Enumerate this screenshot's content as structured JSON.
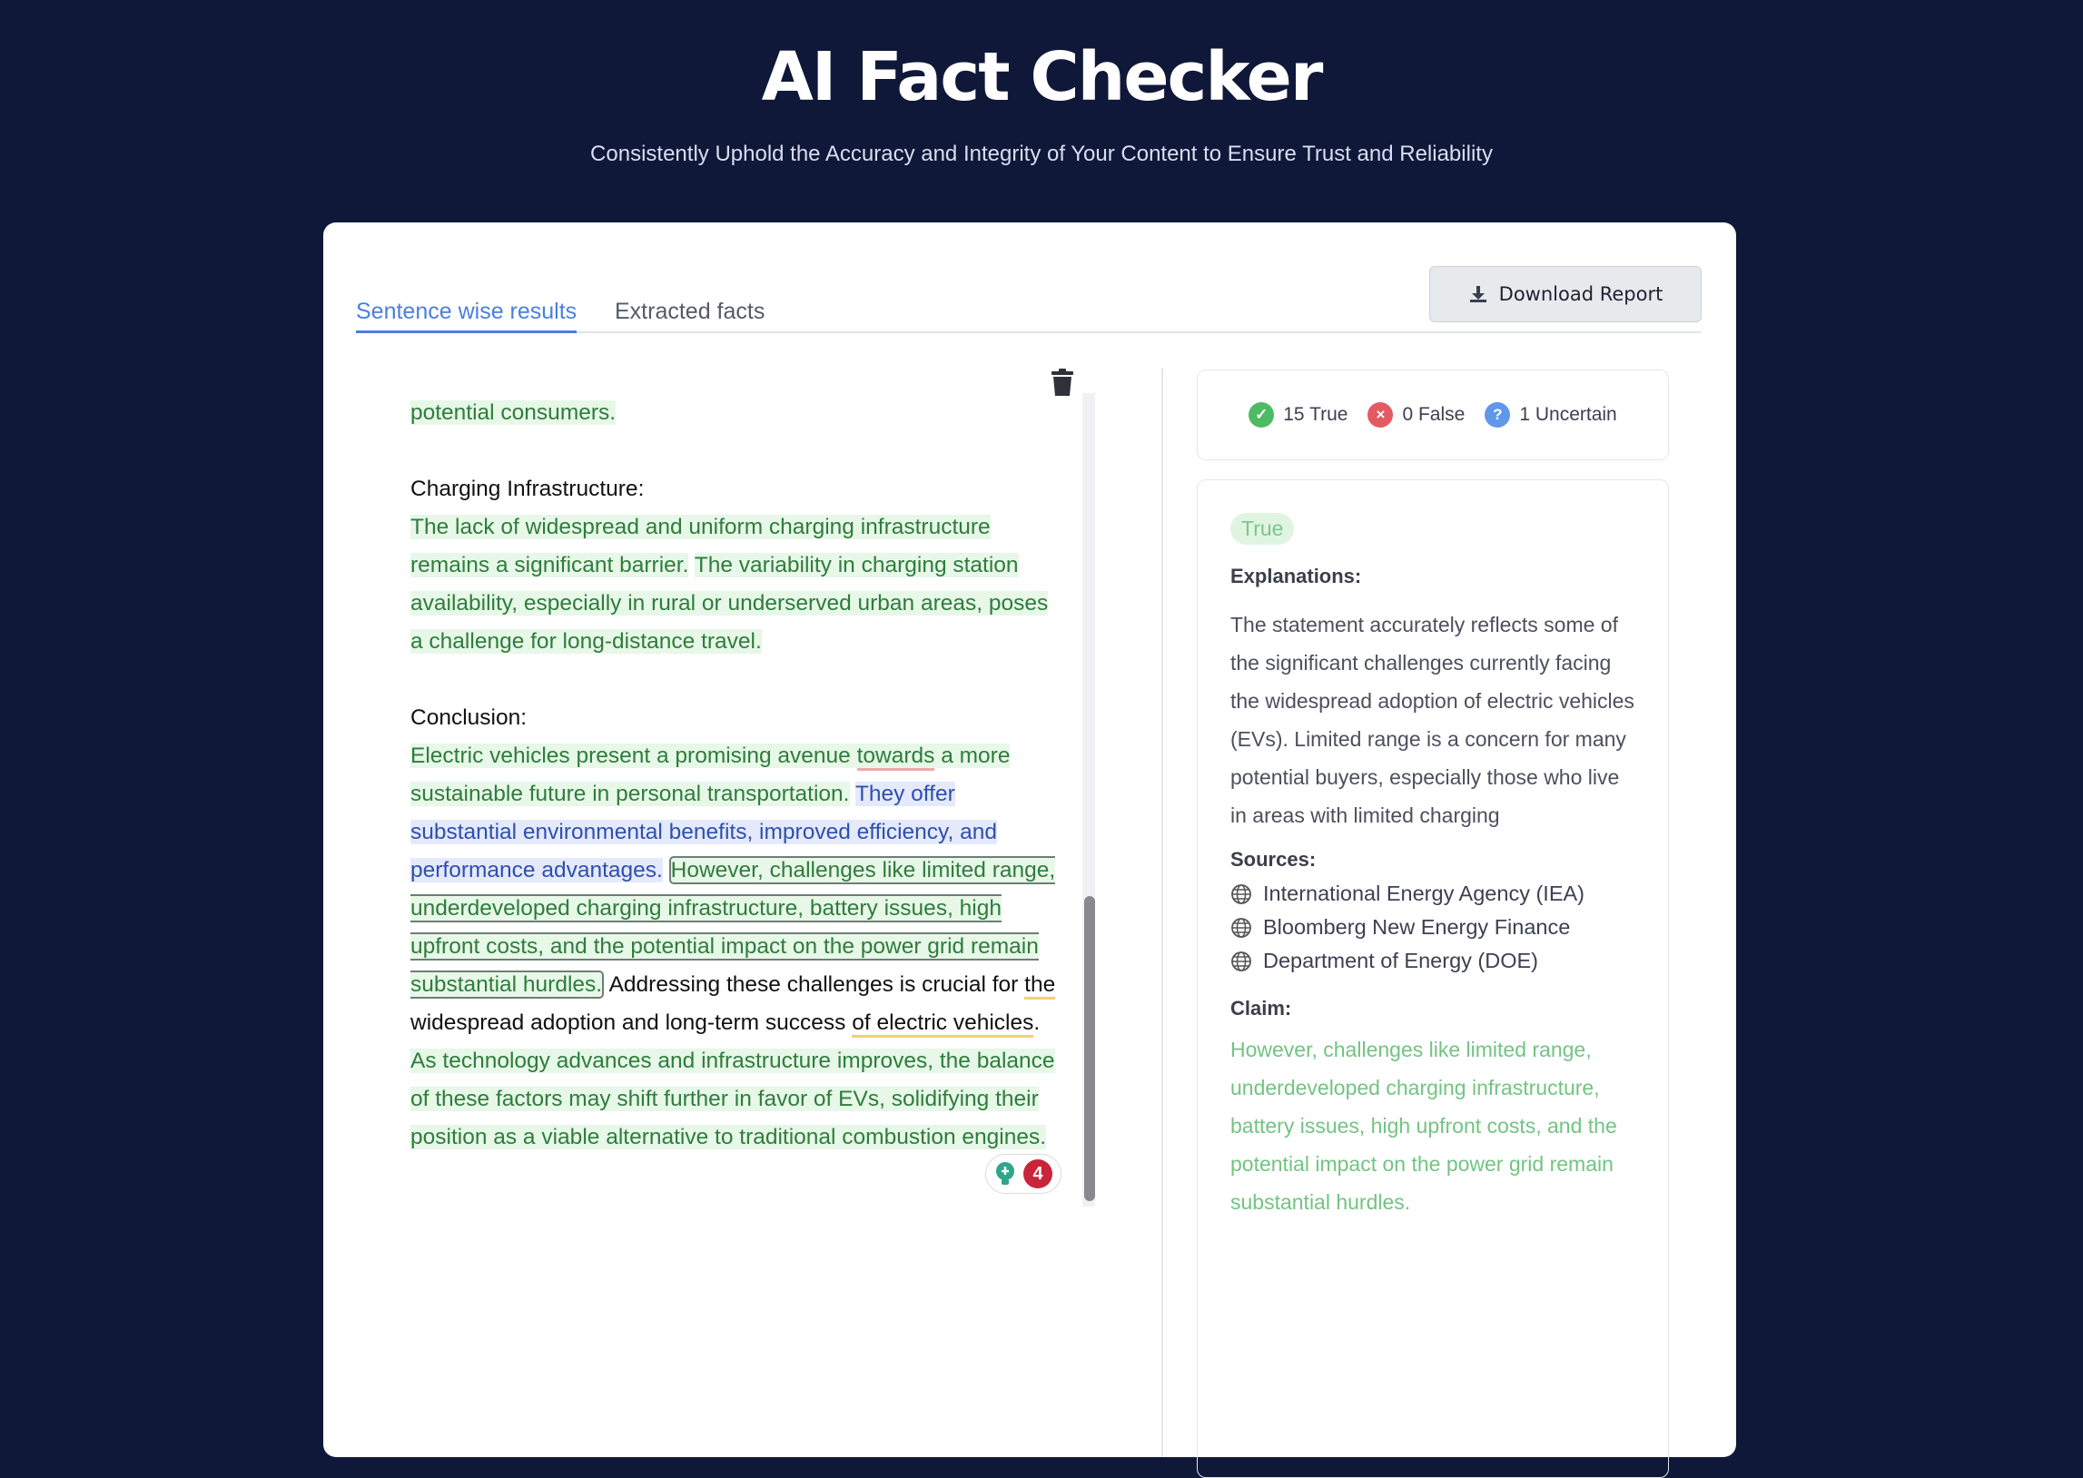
{
  "header": {
    "title": "AI Fact Checker",
    "subtitle": "Consistently Uphold the Accuracy and Integrity of Your Content to Ensure Trust and Reliability"
  },
  "tabs": [
    {
      "label": "Sentence wise results",
      "active": true
    },
    {
      "label": "Extracted facts",
      "active": false
    }
  ],
  "toolbar": {
    "download_label": "Download Report"
  },
  "editor": {
    "line_intro": "potential consumers.",
    "heading_charging": "Charging Infrastructure:",
    "charging_s1": "The lack of widespread and uniform charging infrastructure remains a significant barrier.",
    "charging_s2": "The variability in charging station availability, especially in rural or underserved urban areas, poses a challenge for long-distance travel.",
    "heading_conclusion": "Conclusion:",
    "c1_a": "Electric vehicles present a promising avenue ",
    "c1_b": "towards",
    "c1_c": " a more sustainable future in personal transportation.",
    "c2": "They offer substantial environmental benefits, improved efficiency, and performance advantages.",
    "c3": "However, challenges like limited range, underdeveloped charging infrastructure, battery issues, high upfront costs, and the potential impact on the power grid remain substantial hurdles.",
    "c4_a": "Addressing these challenges is crucial for ",
    "c4_b": "the",
    "c4_c": " widespread adoption and long-term success ",
    "c4_d": "of electric vehicles",
    "c4_e": ".",
    "c5": "As technology advances and infrastructure improves, the balance of these factors may shift further in favor of EVs, solidifying their position as a viable alternative to traditional combustion engines.",
    "issue_count": "4"
  },
  "summary": {
    "true_label": "15 True",
    "false_label": "0 False",
    "uncertain_label": "1 Uncertain"
  },
  "details": {
    "status": "True",
    "explanations_label": "Explanations:",
    "explanation": "The statement accurately reflects some of the significant challenges currently facing the widespread adoption of electric vehicles (EVs). Limited range is a concern for many potential buyers, especially those who live in areas with limited charging",
    "sources_label": "Sources:",
    "sources": [
      "International Energy Agency (IEA)",
      "Bloomberg New Energy Finance",
      "Department of Energy (DOE)"
    ],
    "claim_label": "Claim:",
    "claim": "However, challenges like limited range, underdeveloped charging infrastructure, battery issues, high upfront costs, and the potential impact on the power grid remain substantial hurdles."
  },
  "colors": {
    "background": "#0f1838",
    "accent": "#4a7fe0",
    "true_green": "#4cbb63",
    "false_red": "#e45a63",
    "uncertain_blue": "#5f97ea"
  },
  "icons": [
    "download-icon",
    "trash-icon",
    "check-circle-icon",
    "x-circle-icon",
    "question-circle-icon",
    "globe-icon",
    "lightbulb-icon"
  ]
}
